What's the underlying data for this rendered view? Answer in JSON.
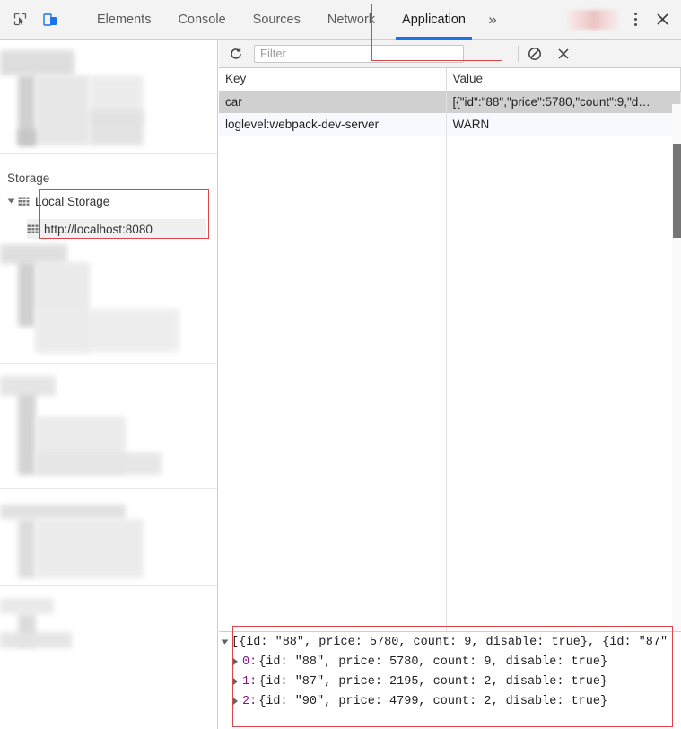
{
  "devtools": {
    "toolbar": {
      "inspect_icon": "inspect-element-icon",
      "device_toolbar_icon": "device-toolbar-icon",
      "more_tabs_label": "»",
      "kebab_icon": "more-options-icon",
      "close_icon": "close-icon",
      "tabs": [
        {
          "label": "Elements",
          "active": false
        },
        {
          "label": "Console",
          "active": false
        },
        {
          "label": "Sources",
          "active": false
        },
        {
          "label": "Network",
          "active": false
        },
        {
          "label": "Application",
          "active": true
        }
      ]
    },
    "filter_bar": {
      "refresh_icon": "refresh-icon",
      "filter_placeholder": "Filter",
      "filter_value": "",
      "clear_all_icon": "clear-all-no-entry-icon",
      "delete_selected_icon": "delete-selected-x-icon"
    },
    "sidebar": {
      "section_title": "Storage",
      "local_storage_label": "Local Storage",
      "origin_label": "http://localhost:8080",
      "expand_triangle_icon": "triangle-expanded-icon",
      "storage_icon": "local-storage-table-icon"
    },
    "table": {
      "columns": [
        "Key",
        "Value"
      ],
      "rows": [
        {
          "key": "car",
          "value": "[{\"id\":\"88\",\"price\":5780,\"count\":9,\"d…",
          "selected": true
        },
        {
          "key": "loglevel:webpack-dev-server",
          "value": "WARN",
          "selected": false
        }
      ]
    },
    "console": {
      "root_line": "[{id: \"88\", price: 5780, count: 9, disable: true}, {id: \"87\"",
      "entries": [
        {
          "index": "0:",
          "text": "{id: \"88\", price: 5780, count: 9, disable: true}"
        },
        {
          "index": "1:",
          "text": "{id: \"87\", price: 2195, count: 2, disable: true}"
        },
        {
          "index": "2:",
          "text": "{id: \"90\", price: 4799, count: 2, disable: true}"
        }
      ]
    },
    "annotations": {
      "accent_color": "#e0434a",
      "application_tab_highlight": "Application",
      "local_storage_highlight": "Local Storage / http://localhost:8080",
      "console_output_highlight": "console array output"
    }
  }
}
